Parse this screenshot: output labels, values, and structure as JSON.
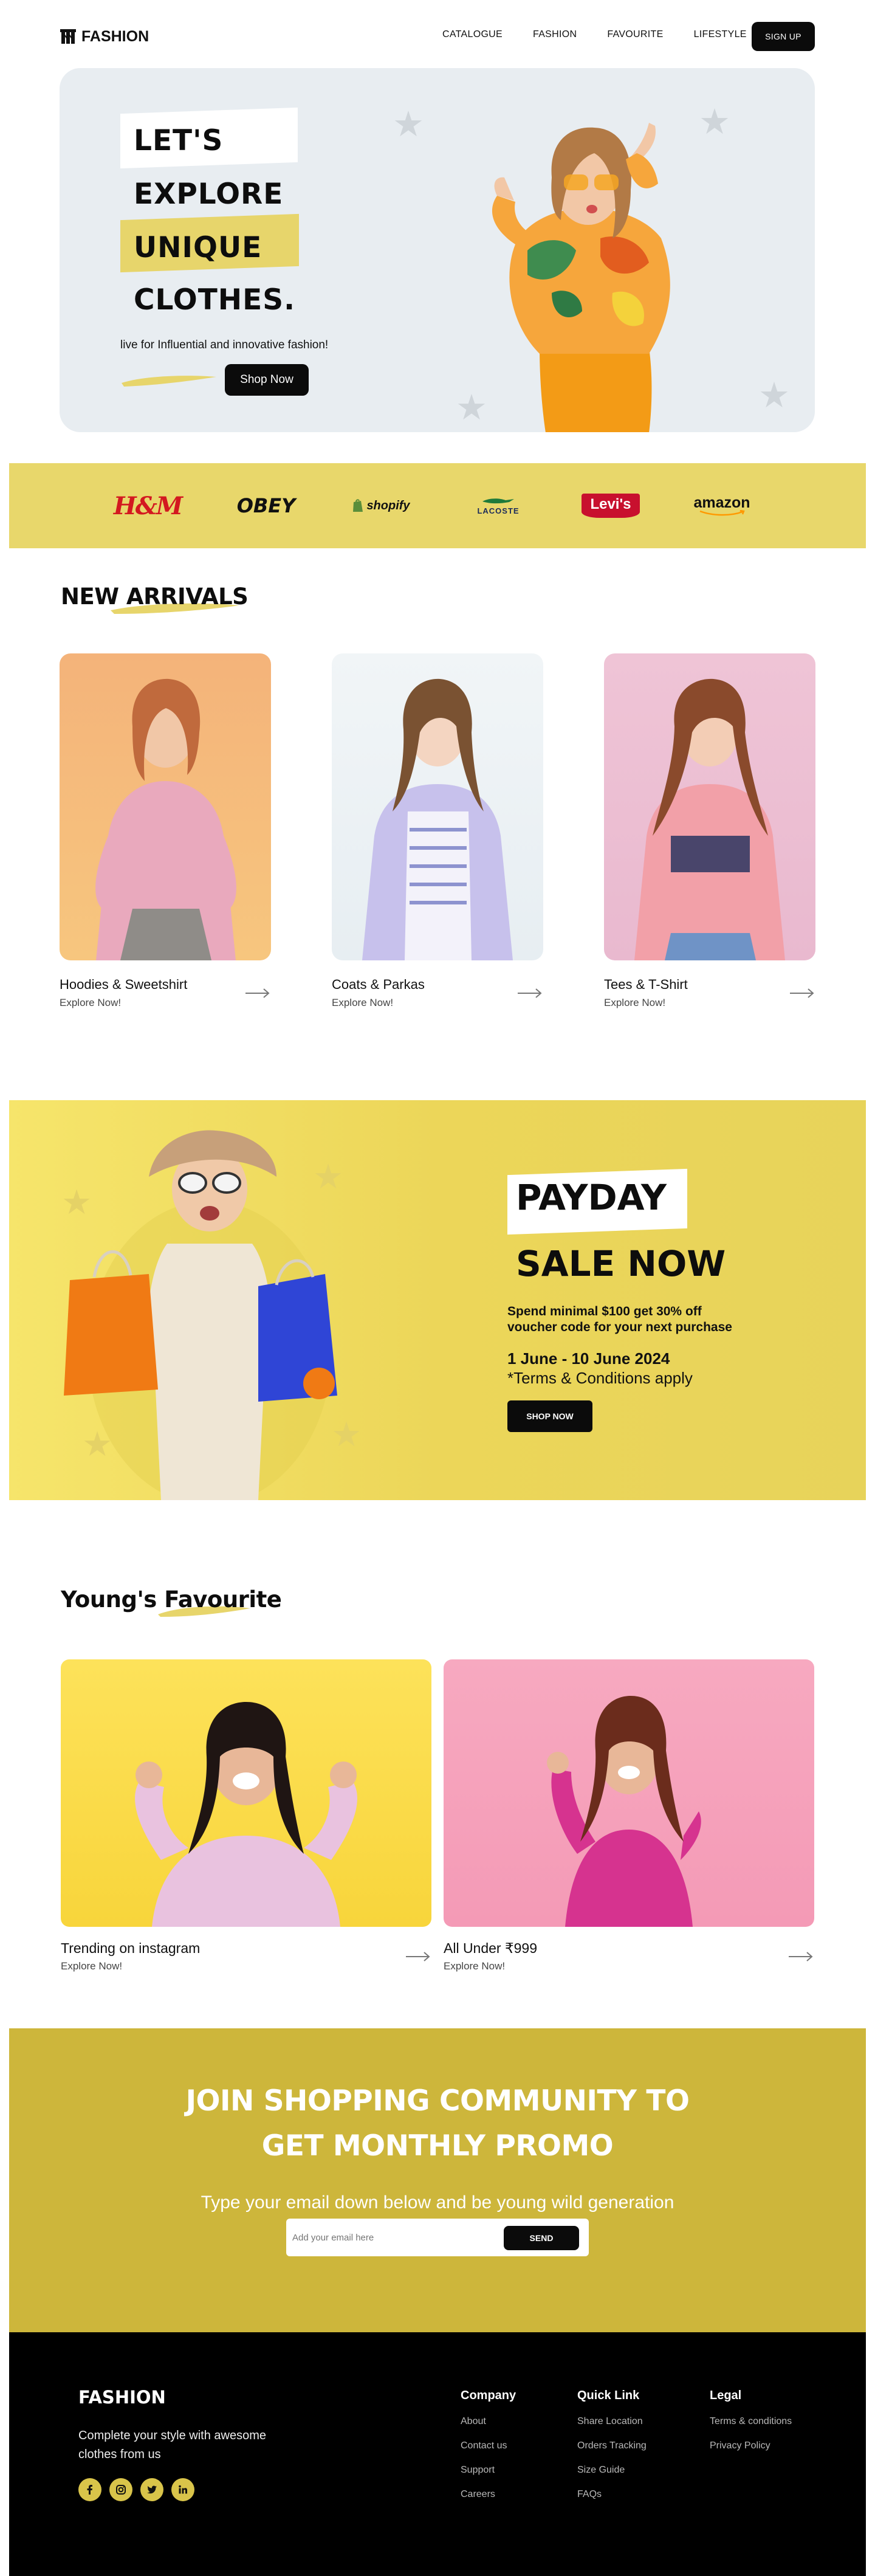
{
  "nav": {
    "logo_text": "FASHION",
    "menu": [
      "CATALOGUE",
      "FASHION",
      "FAVOURITE",
      "LIFESTYLE"
    ],
    "signup_label": "SIGN UP"
  },
  "hero": {
    "lines": [
      "LET'S",
      "EXPLORE",
      "UNIQUE",
      "CLOTHES."
    ],
    "subtitle": "live for Influential and innovative fashion!",
    "cta_label": "Shop Now",
    "colors": {
      "background": "#e8edf1",
      "highlight": "#e7d56b"
    }
  },
  "brands": {
    "items": [
      "H&M",
      "OBEY",
      "shopify",
      "LACOSTE",
      "Levi's",
      "amazon"
    ],
    "background": "#e8d76b"
  },
  "new_arrivals": {
    "title": "NEW ARRIVALS",
    "cards": [
      {
        "title": "Hoodies & Sweetshirt",
        "subtitle": "Explore Now!",
        "arrow_icon": "arrow-right-icon"
      },
      {
        "title": "Coats & Parkas",
        "subtitle": "Explore Now!",
        "arrow_icon": "arrow-right-icon"
      },
      {
        "title": "Tees & T-Shirt",
        "subtitle": "Explore Now!",
        "arrow_icon": "arrow-right-icon"
      }
    ]
  },
  "payday": {
    "heading_1": "PAYDAY",
    "heading_2": "SALE NOW",
    "offer": "Spend minimal $100 get 30% off",
    "offer_2": "voucher code for your next purchase",
    "dates": "1 June - 10 June 2024",
    "terms": "*Terms & Conditions apply",
    "cta_label": "SHOP NOW"
  },
  "young": {
    "title_part1": "Young's ",
    "title_part2": "Favourite",
    "cards": [
      {
        "title": "Trending on instagram",
        "subtitle": "Explore Now!"
      },
      {
        "title": "All Under ₹999",
        "subtitle": "Explore Now!"
      }
    ]
  },
  "community": {
    "title_line1": "JOIN SHOPPING COMMUNITY TO",
    "title_line2": "GET MONTHLY PROMO",
    "subtitle": "Type your email down below and be young wild generation",
    "email_placeholder": "Add your email here",
    "send_label": "SEND",
    "background": "#cdb63b"
  },
  "footer": {
    "logo_text": "FASHION",
    "description": "Complete your style with awesome clothes from us",
    "social_icons": [
      "facebook-icon",
      "instagram-icon",
      "twitter-icon",
      "linkedin-icon"
    ],
    "columns": [
      {
        "heading": "Company",
        "links": [
          "About",
          "Contact us",
          "Support",
          "Careers"
        ]
      },
      {
        "heading": "Quick Link",
        "links": [
          "Share Location",
          "Orders Tracking",
          "Size Guide",
          "FAQs"
        ]
      },
      {
        "heading": "Legal",
        "links": [
          "Terms & conditions",
          "Privacy Policy"
        ]
      }
    ]
  }
}
